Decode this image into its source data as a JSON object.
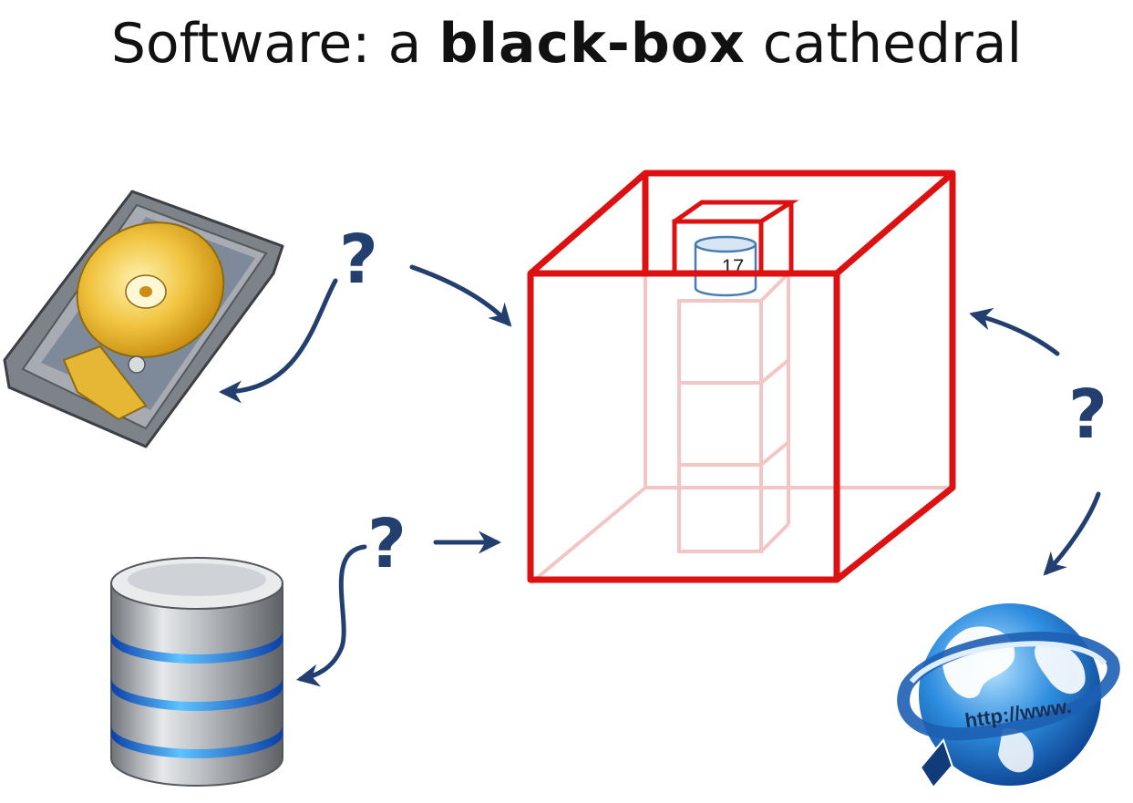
{
  "title": {
    "prefix": "Software: a ",
    "emphasis": "black-box",
    "suffix": " cathedral"
  },
  "inner_box_label": "17",
  "question_mark": "?",
  "globe_label": "http://www.",
  "colors": {
    "cube": "#dd1111",
    "arrow": "#233f6f",
    "question": "#233f6f",
    "title": "#111111"
  },
  "icons": [
    "hard-drive-icon",
    "database-icon",
    "globe-icon"
  ]
}
